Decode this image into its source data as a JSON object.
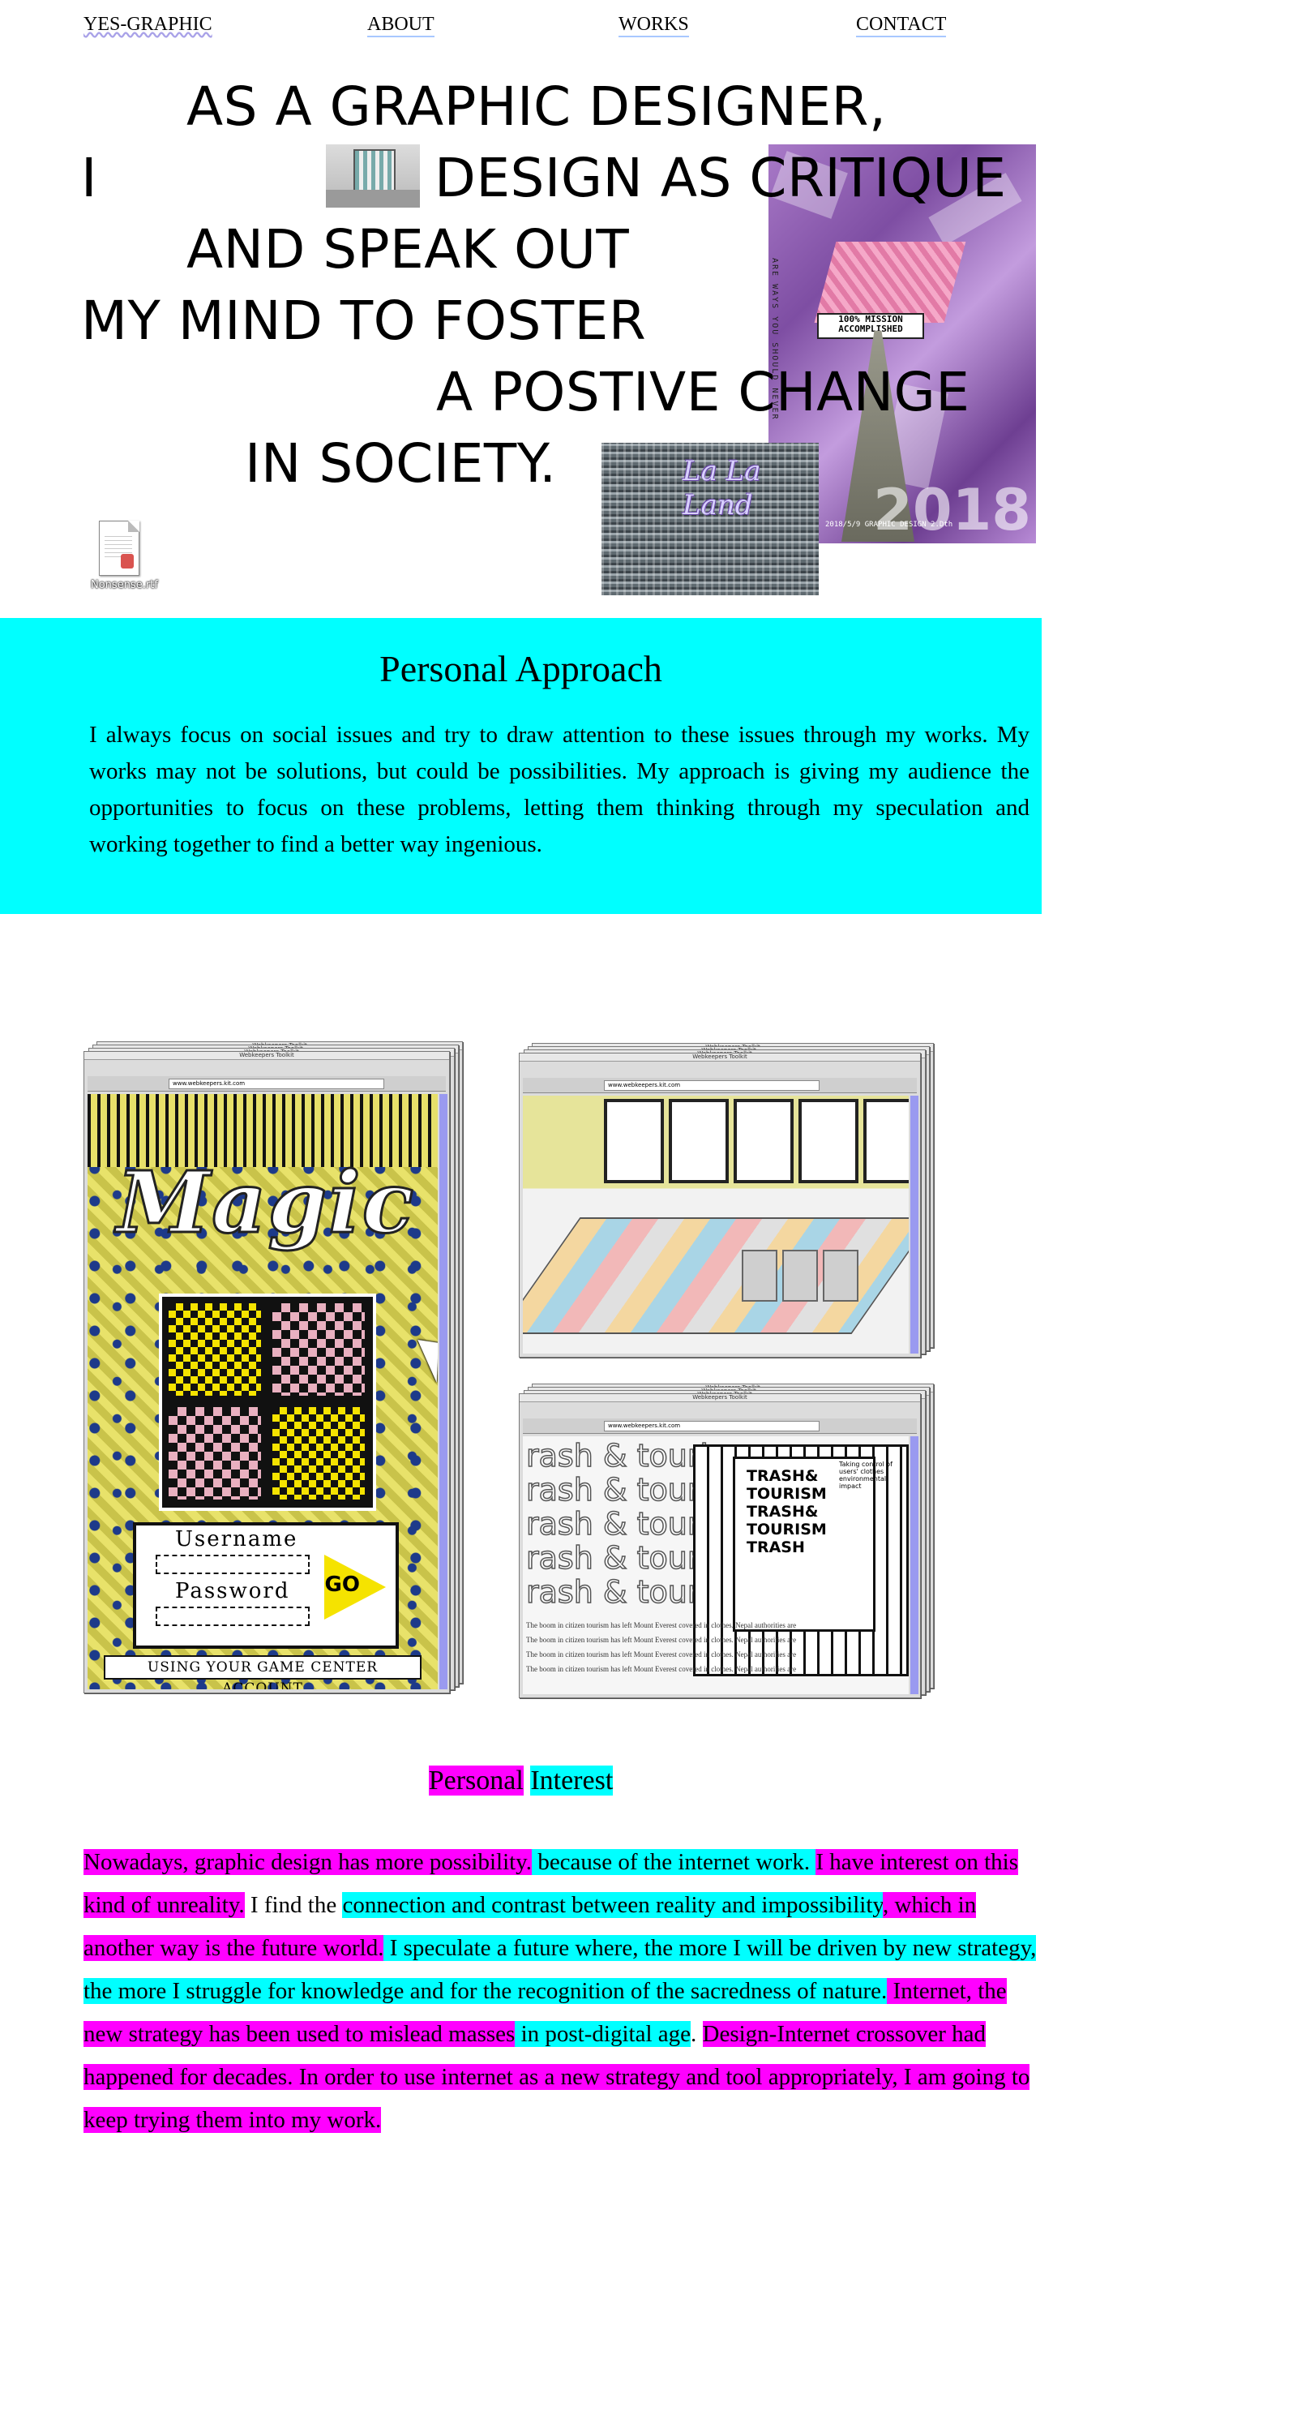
{
  "nav": {
    "brand": "YES-GRAPHIC",
    "about": "ABOUT",
    "works": "WORKS",
    "contact": "CONTACT"
  },
  "hero": {
    "lines": [
      "AS A GRAPHIC DESIGNER,",
      "I",
      "DESIGN AS CRITIQUE",
      "AND SPEAK OUT",
      "MY MIND TO FOSTER",
      "A POSTIVE CHANGE",
      "IN SOCIETY."
    ],
    "poster": {
      "mission_text": "100% MISSION ACCOMPLISHED",
      "vertical_text": "ARE WAYS YOU SHOULD NEVER",
      "footer_text": "2018/5/9 GRAPHIC DESIGN 2.Dth",
      "year": "2018"
    },
    "traffic_image_text": "La La Land",
    "file_icon_label": "Nonsense.rtf"
  },
  "approach": {
    "title": "Personal Approach",
    "body": "I always focus on social issues and try to draw attention to these issues through my works. My works may not be solutions, but could be possibilities. My approach is giving my audience the opportunities to focus on these problems, letting them thinking through my speculation and working together to find a better way ingenious."
  },
  "works": {
    "browser_title": "Webkeepers Toolkit",
    "url": "www.webkeepers.kit.com",
    "magic": {
      "title": "Magic",
      "username_label": "Username",
      "password_label": "Password",
      "go_label": "GO",
      "footer": "USING YOUR GAME CENTER ACCOUNT"
    },
    "trash": {
      "repeat_text": "rash & touris",
      "stack_title": [
        "TRASH&",
        "TOURISM",
        "TRASH&",
        "TOURISM",
        "TRASH"
      ],
      "side_text": "Taking control of users' clothes environmental impact",
      "caption": "The boom in citizen tourism has left Mount Everest covered in clothes. Nepal authorities are"
    }
  },
  "interest": {
    "title_part1": "Personal",
    "title_part2": "Interest",
    "segments": [
      {
        "text": "Nowadays, graphic design has more possibility.",
        "hl": "m"
      },
      {
        "text": " because of the internet work. ",
        "hl": "c"
      },
      {
        "text": "I have interest on this kind of unreality.",
        "hl": "m"
      },
      {
        "text": " I find the ",
        "hl": ""
      },
      {
        "text": "connection and contrast between reality and impossibility",
        "hl": "c"
      },
      {
        "text": ", which in another way is the future world.",
        "hl": "m"
      },
      {
        "text": " I speculate a future where, the more I will be driven by new strategy, the more I struggle for knowledge and for the recognition of the sacredness of nature.",
        "hl": "c"
      },
      {
        "text": " Internet, the new strategy has been used to mislead masses",
        "hl": "m"
      },
      {
        "text": " in post-digital age",
        "hl": "c"
      },
      {
        "text": ". ",
        "hl": ""
      },
      {
        "text": "Design-Internet crossover had happened for decades. In order to use internet as a new strategy and tool appropriately, I am going to keep trying them into my work.",
        "hl": "m"
      }
    ]
  },
  "colors": {
    "cyan": "#00ffff",
    "magenta": "#ff00ff",
    "nav_underline": "#a8c8ff"
  }
}
